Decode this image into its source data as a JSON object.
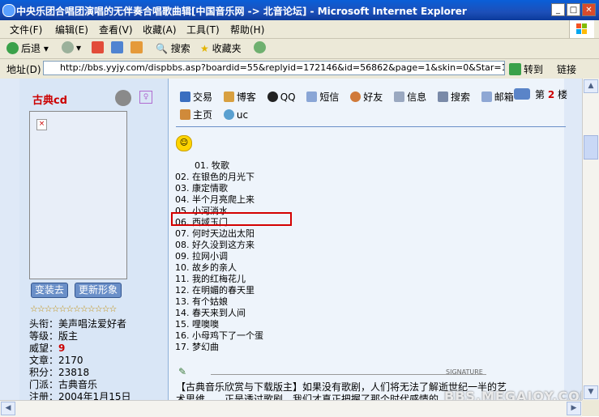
{
  "window": {
    "title": "中央乐团合唱团演唱的无伴奏合唱歌曲辑[中国音乐网 -> 北音论坛] - Microsoft Internet Explorer",
    "min_icon": "minimize-icon",
    "max_icon": "maximize-icon",
    "close_icon": "close-icon"
  },
  "menu": [
    "文件(F)",
    "编辑(E)",
    "查看(V)",
    "收藏(A)",
    "工具(T)",
    "帮助(H)"
  ],
  "toolbar": {
    "back": "后退",
    "search": "搜索",
    "favorites": "收藏夹"
  },
  "address": {
    "label": "地址(D)",
    "url": "http://bbs.yyjy.com/dispbbs.asp?boardid=55&replyid=172146&id=56862&page=1&skin=0&Star=1",
    "go": "转到",
    "links": "链接"
  },
  "user": {
    "name": "古典cd",
    "btn_change": "变装去",
    "btn_update": "更新形象",
    "stars": "☆☆☆☆☆☆☆☆☆☆☆☆",
    "info": [
      {
        "label": "头衔：",
        "value": "美声唱法爱好者"
      },
      {
        "label": "等级：",
        "value": "版主"
      },
      {
        "label": "威望：",
        "value": "9"
      },
      {
        "label": "文章：",
        "value": "2170"
      },
      {
        "label": "积分：",
        "value": "23818"
      },
      {
        "label": "门派：",
        "value": "古典音乐"
      },
      {
        "label": "注册：",
        "value": "2004年1月15日"
      }
    ]
  },
  "nav": {
    "row1": [
      "交易",
      "博客",
      "QQ",
      "短信",
      "好友",
      "信息",
      "搜索",
      "邮箱"
    ],
    "row2": [
      "主页",
      "uc"
    ],
    "floor_prefix": "第",
    "floor_num": "2",
    "floor_suffix": "楼"
  },
  "songs": [
    "01. 牧歌",
    "02. 在银色的月光下",
    "03. 康定情歌",
    "04. 半个月亮爬上来",
    "05. 小河淌水",
    "06. 西域玉门",
    "07. 何时天边出太阳",
    "08. 好久没到这方来",
    "09. 拉网小调",
    "10. 故乡的亲人",
    "11. 我的红梅花儿",
    "12. 在明媚的春天里",
    "13. 有个姑娘",
    "14. 春天来到人间",
    "15. 哩噢噢",
    "16. 小母鸡下了一个蛋",
    "17. 梦幻曲"
  ],
  "signature": {
    "label": "SIGNATURE",
    "line1": "【古典音乐欣赏与下载版主】如果没有歌剧，人们将无法了解逝世纪一半的艺",
    "line2": "术思维……正是透过歌剧，我们才真正把握了那个时代感情的"
  },
  "watermark": "BBS.MEGAJOY.COM"
}
